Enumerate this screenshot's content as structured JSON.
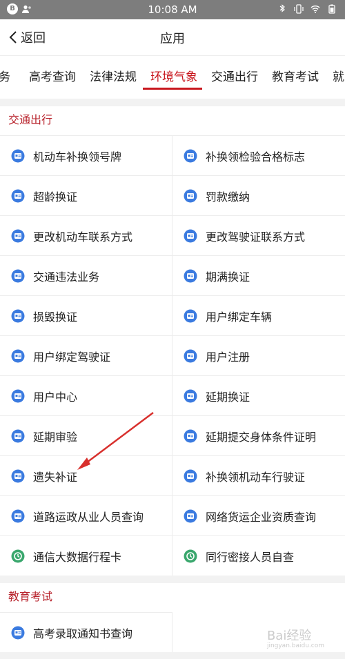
{
  "status_bar": {
    "time": "10:08 AM",
    "badge": "B"
  },
  "header": {
    "back_label": "返回",
    "title": "应用"
  },
  "tabs": [
    {
      "label": "务"
    },
    {
      "label": "高考查询"
    },
    {
      "label": "法律法规"
    },
    {
      "label": "环境气象",
      "active": true
    },
    {
      "label": "交通出行"
    },
    {
      "label": "教育考试"
    },
    {
      "label": "就"
    }
  ],
  "sections": [
    {
      "title": "交通出行",
      "items": [
        {
          "label": "机动车补换领号牌",
          "icon": "license-plate-icon",
          "color": "#3b7be0"
        },
        {
          "label": "补换领检验合格标志",
          "icon": "document-icon",
          "color": "#3b7be0"
        },
        {
          "label": "超龄换证",
          "icon": "id-card-icon",
          "color": "#3b7be0"
        },
        {
          "label": "罚款缴纳",
          "icon": "money-bag-icon",
          "color": "#3b7be0"
        },
        {
          "label": "更改机动车联系方式",
          "icon": "edit-document-icon",
          "color": "#3b7be0"
        },
        {
          "label": "更改驾驶证联系方式",
          "icon": "pencil-icon",
          "color": "#3b7be0"
        },
        {
          "label": "交通违法业务",
          "icon": "car-icon",
          "color": "#3b7be0"
        },
        {
          "label": "期满换证",
          "icon": "card-icon",
          "color": "#3b7be0"
        },
        {
          "label": "损毁换证",
          "icon": "damaged-card-icon",
          "color": "#3b7be0"
        },
        {
          "label": "用户绑定车辆",
          "icon": "car-bind-icon",
          "color": "#3b7be0"
        },
        {
          "label": "用户绑定驾驶证",
          "icon": "license-bind-icon",
          "color": "#3b7be0"
        },
        {
          "label": "用户注册",
          "icon": "user-register-icon",
          "color": "#3b7be0"
        },
        {
          "label": "用户中心",
          "icon": "user-icon",
          "color": "#3b7be0"
        },
        {
          "label": "延期换证",
          "icon": "extend-card-icon",
          "color": "#3b7be0"
        },
        {
          "label": "延期审验",
          "icon": "clock-icon",
          "color": "#3b7be0"
        },
        {
          "label": "延期提交身体条件证明",
          "icon": "health-document-icon",
          "color": "#3b7be0"
        },
        {
          "label": "遗失补证",
          "icon": "lost-card-icon",
          "color": "#3b7be0"
        },
        {
          "label": "补换领机动车行驶证",
          "icon": "vehicle-license-icon",
          "color": "#3b7be0"
        },
        {
          "label": "道路运政从业人员查询",
          "icon": "staff-query-icon",
          "color": "#3b7be0"
        },
        {
          "label": "网络货运企业资质查询",
          "icon": "truck-query-icon",
          "color": "#3b7be0"
        },
        {
          "label": "通信大数据行程卡",
          "icon": "trip-card-icon",
          "color": "#3aa76d"
        },
        {
          "label": "同行密接人员自查",
          "icon": "contacts-check-icon",
          "color": "#3aa76d"
        }
      ]
    },
    {
      "title": "教育考试",
      "items": [
        {
          "label": "高考录取通知书查询",
          "icon": "admission-letter-icon",
          "color": "#3b7be0"
        }
      ]
    }
  ],
  "watermark": {
    "text": "Bai经验",
    "sub": "jingyan.baidu.com"
  },
  "colors": {
    "accent": "#c8161d",
    "section_title": "#b8232c",
    "icon_blue": "#3b7be0",
    "icon_green": "#3aa76d",
    "annotation_arrow": "#d8302d"
  }
}
